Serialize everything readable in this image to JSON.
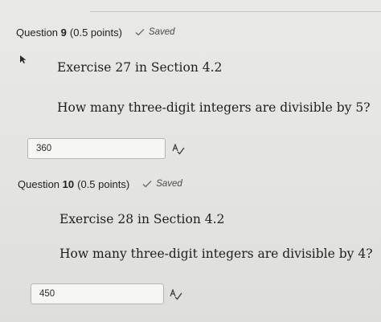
{
  "questions": [
    {
      "title_prefix": "Question",
      "number": "9",
      "points": "(0.5 points)",
      "status": "Saved",
      "exercise": "Exercise 27 in Section 4.2",
      "prompt": "How many three-digit integers are divisible by 5?",
      "answer": "360"
    },
    {
      "title_prefix": "Question",
      "number": "10",
      "points": "(0.5 points)",
      "status": "Saved",
      "exercise": "Exercise 28 in Section 4.2",
      "prompt": "How many three-digit integers are divisible by 4?",
      "answer": "450"
    }
  ],
  "icons": {
    "status": "checkmark-icon",
    "spellcheck": "spellcheck-icon",
    "pointer": "mouse-pointer-icon"
  },
  "colors": {
    "background": "#e6e6e4",
    "input_background": "#f6f6f4",
    "input_border": "#b5b5b3",
    "text": "#222222"
  }
}
